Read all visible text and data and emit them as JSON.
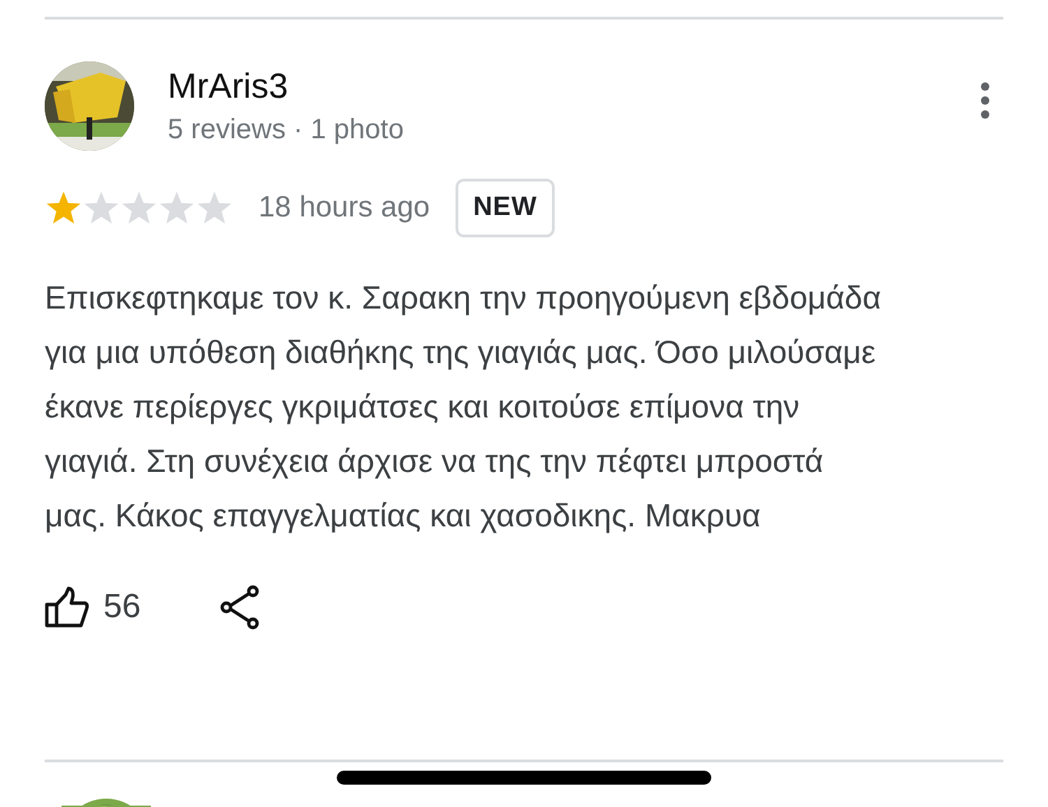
{
  "review": {
    "author": "MrAris3",
    "meta": "5 reviews · 1 photo",
    "stars": 1,
    "time": "18 hours ago",
    "badge": "NEW",
    "text": "Επισκεφτηκαμε τον κ. Σαρακη την προηγούμενη εβδομάδα για μια υπόθεση διαθήκης της γιαγιάς μας. Όσο μιλούσαμε έκανε περίεργες γκριμάτσες και κοιτούσε επίμονα την γιαγιά. Στη συνέχεια άρχισε να της την πέφτει μπροστά μας. Κάκος επαγγελματίας και χασοδικης. Μακρυα",
    "likes": "56"
  }
}
